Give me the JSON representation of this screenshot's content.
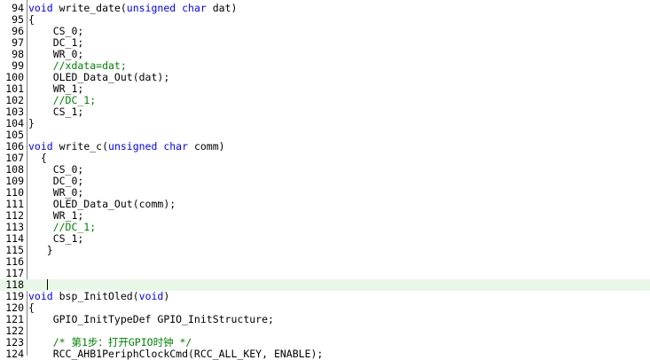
{
  "editor": {
    "lines": [
      {
        "n": "94",
        "segs": [
          {
            "t": "kw",
            "v": "void"
          },
          {
            "t": "tx",
            "v": " write_date("
          },
          {
            "t": "kw",
            "v": "unsigned char"
          },
          {
            "t": "tx",
            "v": " dat)"
          }
        ]
      },
      {
        "n": "95",
        "segs": [
          {
            "t": "tx",
            "v": "{"
          }
        ]
      },
      {
        "n": "96",
        "segs": [
          {
            "t": "tx",
            "v": "    CS_0;"
          }
        ]
      },
      {
        "n": "97",
        "segs": [
          {
            "t": "tx",
            "v": "    DC_1;"
          }
        ]
      },
      {
        "n": "98",
        "segs": [
          {
            "t": "tx",
            "v": "    WR_0;"
          }
        ]
      },
      {
        "n": "99",
        "segs": [
          {
            "t": "cm",
            "v": "    //xdata=dat;"
          }
        ]
      },
      {
        "n": "100",
        "segs": [
          {
            "t": "tx",
            "v": "    OLED_Data_Out(dat);"
          }
        ]
      },
      {
        "n": "101",
        "segs": [
          {
            "t": "tx",
            "v": "    WR_1;"
          }
        ]
      },
      {
        "n": "102",
        "segs": [
          {
            "t": "cm",
            "v": "    //DC_1;"
          }
        ]
      },
      {
        "n": "103",
        "segs": [
          {
            "t": "tx",
            "v": "    CS_1;"
          }
        ]
      },
      {
        "n": "104",
        "segs": [
          {
            "t": "tx",
            "v": "}"
          }
        ]
      },
      {
        "n": "105",
        "segs": []
      },
      {
        "n": "106",
        "segs": [
          {
            "t": "kw",
            "v": "void"
          },
          {
            "t": "tx",
            "v": " write_c("
          },
          {
            "t": "kw",
            "v": "unsigned char"
          },
          {
            "t": "tx",
            "v": " comm)"
          }
        ]
      },
      {
        "n": "107",
        "segs": [
          {
            "t": "tx",
            "v": "  {"
          }
        ]
      },
      {
        "n": "108",
        "segs": [
          {
            "t": "tx",
            "v": "    CS_0;"
          }
        ]
      },
      {
        "n": "109",
        "segs": [
          {
            "t": "tx",
            "v": "    DC_0;"
          }
        ]
      },
      {
        "n": "110",
        "segs": [
          {
            "t": "tx",
            "v": "    WR_0;"
          }
        ]
      },
      {
        "n": "111",
        "segs": [
          {
            "t": "tx",
            "v": "    OLED_Data_Out(comm);"
          }
        ]
      },
      {
        "n": "112",
        "segs": [
          {
            "t": "tx",
            "v": "    WR_1;"
          }
        ]
      },
      {
        "n": "113",
        "segs": [
          {
            "t": "cm",
            "v": "    //DC_1;"
          }
        ]
      },
      {
        "n": "114",
        "segs": [
          {
            "t": "tx",
            "v": "    CS_1;"
          }
        ]
      },
      {
        "n": "115",
        "segs": [
          {
            "t": "tx",
            "v": "   }"
          }
        ]
      },
      {
        "n": "116",
        "segs": []
      },
      {
        "n": "117",
        "segs": []
      },
      {
        "n": "118",
        "segs": [
          {
            "t": "tx",
            "v": "   "
          }
        ],
        "current": true,
        "caret": true
      },
      {
        "n": "119",
        "segs": [
          {
            "t": "kw",
            "v": "void"
          },
          {
            "t": "tx",
            "v": " bsp_InitOled("
          },
          {
            "t": "kw",
            "v": "void"
          },
          {
            "t": "tx",
            "v": ")"
          }
        ]
      },
      {
        "n": "120",
        "segs": [
          {
            "t": "tx",
            "v": "{"
          }
        ]
      },
      {
        "n": "121",
        "segs": [
          {
            "t": "tx",
            "v": "    GPIO_InitTypeDef GPIO_InitStructure;"
          }
        ]
      },
      {
        "n": "122",
        "segs": []
      },
      {
        "n": "123",
        "segs": [
          {
            "t": "cm",
            "v": "    /* 第1步：打开GPIO时钟 */"
          }
        ]
      },
      {
        "n": "124",
        "segs": [
          {
            "t": "tx",
            "v": "    RCC_AHB1PeriphClockCmd(RCC_ALL_KEY, ENABLE);"
          }
        ]
      }
    ]
  }
}
